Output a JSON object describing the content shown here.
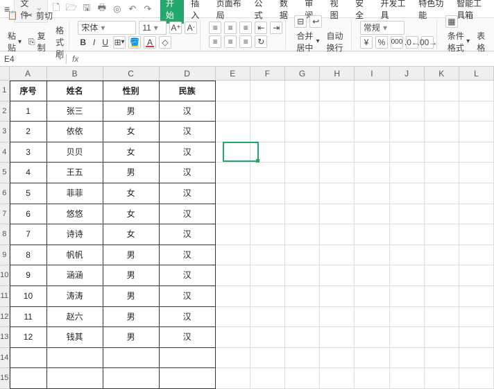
{
  "menu": {
    "file_label": "文件",
    "tabs": [
      "开始",
      "插入",
      "页面布局",
      "公式",
      "数据",
      "审阅",
      "视图",
      "安全",
      "开发工具",
      "特色功能",
      "智能工具箱"
    ],
    "active_tab": 0
  },
  "ribbon": {
    "paste": "粘贴",
    "cut": "剪切",
    "copy": "复制",
    "format_painter": "格式刷",
    "font_name": "宋体",
    "font_size": "11",
    "bold": "B",
    "italic": "I",
    "underline": "U",
    "merge_center": "合并居中",
    "wrap_text": "自动换行",
    "number_format": "常规",
    "cond_format": "条件格式",
    "table_style": "表格"
  },
  "formula_bar": {
    "namebox": "E4",
    "fx": "fx",
    "value": ""
  },
  "columns": [
    "A",
    "B",
    "C",
    "D",
    "E",
    "F",
    "G",
    "H",
    "I",
    "J",
    "K",
    "L"
  ],
  "col_widths": [
    "col-A",
    "col-B",
    "col-C",
    "col-D",
    "col-E",
    "col-F",
    "col-G",
    "col-H",
    "col-I",
    "col-J",
    "col-K",
    "col-L"
  ],
  "row_headers": [
    "1",
    "2",
    "3",
    "4",
    "5",
    "6",
    "7",
    "8",
    "9",
    "10",
    "11",
    "12",
    "13",
    "14",
    "15"
  ],
  "table": {
    "headers": [
      "序号",
      "姓名",
      "性别",
      "民族"
    ],
    "rows": [
      [
        "1",
        "张三",
        "男",
        "汉"
      ],
      [
        "2",
        "依依",
        "女",
        "汉"
      ],
      [
        "3",
        "贝贝",
        "女",
        "汉"
      ],
      [
        "4",
        "王五",
        "男",
        "汉"
      ],
      [
        "5",
        "菲菲",
        "女",
        "汉"
      ],
      [
        "6",
        "悠悠",
        "女",
        "汉"
      ],
      [
        "7",
        "诗诗",
        "女",
        "汉"
      ],
      [
        "8",
        "帆帆",
        "男",
        "汉"
      ],
      [
        "9",
        "涵涵",
        "男",
        "汉"
      ],
      [
        "10",
        "涛涛",
        "男",
        "汉"
      ],
      [
        "11",
        "赵六",
        "男",
        "汉"
      ],
      [
        "12",
        "钱其",
        "男",
        "汉"
      ]
    ]
  },
  "selection": {
    "col": 4,
    "row": 3
  }
}
